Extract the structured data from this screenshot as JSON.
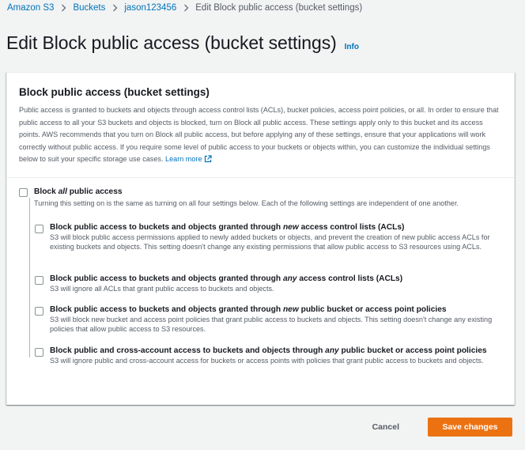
{
  "breadcrumb": {
    "items": [
      "Amazon S3",
      "Buckets",
      "jason123456"
    ],
    "current": "Edit Block public access (bucket settings)"
  },
  "page": {
    "title": "Edit Block public access (bucket settings)",
    "info": "Info"
  },
  "panel": {
    "heading": "Block public access (bucket settings)",
    "description": "Public access is granted to buckets and objects through access control lists (ACLs), bucket policies, access point policies, or all. In order to ensure that public access to all your S3 buckets and objects is blocked, turn on Block all public access. These settings apply only to this bucket and its access points. AWS recommends that you turn on Block all public access, but before applying any of these settings, ensure that your applications will work correctly without public access. If you require some level of public access to your buckets or objects within, you can customize the individual settings below to suit your specific storage use cases.",
    "learn_more": "Learn more"
  },
  "block_all": {
    "title_pre": "Block ",
    "title_em": "all",
    "title_post": " public access",
    "description": "Turning this setting on is the same as turning on all four settings below. Each of the following settings are independent of one another.",
    "checked": false
  },
  "options": [
    {
      "title_pre": "Block public access to buckets and objects granted through ",
      "title_em": "new",
      "title_post": " access control lists (ACLs)",
      "description": "S3 will block public access permissions applied to newly added buckets or objects, and prevent the creation of new public access ACLs for existing buckets and objects. This setting doesn't change any existing permissions that allow public access to S3 resources using ACLs.",
      "checked": false
    },
    {
      "title_pre": "Block public access to buckets and objects granted through ",
      "title_em": "any",
      "title_post": " access control lists (ACLs)",
      "description": "S3 will ignore all ACLs that grant public access to buckets and objects.",
      "checked": false
    },
    {
      "title_pre": "Block public access to buckets and objects granted through ",
      "title_em": "new",
      "title_post": " public bucket or access point policies",
      "description": "S3 will block new bucket and access point policies that grant public access to buckets and objects. This setting doesn't change any existing policies that allow public access to S3 resources.",
      "checked": false
    },
    {
      "title_pre": "Block public and cross-account access to buckets and objects through ",
      "title_em": "any",
      "title_post": " public bucket or access point policies",
      "description": "S3 will ignore public and cross-account access for buckets or access points with policies that grant public access to buckets and objects.",
      "checked": false
    }
  ],
  "actions": {
    "cancel": "Cancel",
    "save": "Save changes"
  },
  "colors": {
    "link": "#0073bb",
    "primary_button": "#ec7211",
    "background": "#f2f3f3"
  }
}
